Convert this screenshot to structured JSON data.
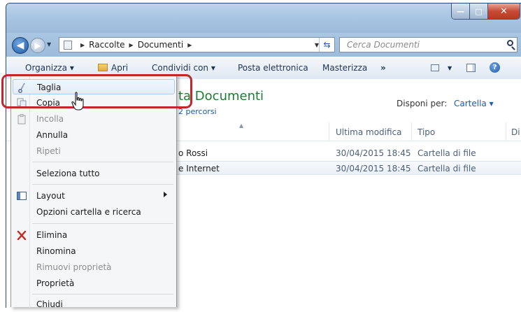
{
  "window": {
    "minimize": "—",
    "maximize": "□",
    "close": "✕"
  },
  "address": {
    "crumbs": [
      "Raccolte",
      "Documenti"
    ]
  },
  "search": {
    "placeholder": "Cerca Documenti"
  },
  "toolbar": {
    "organizza": "Organizza ▾",
    "apri": "Apri",
    "condividi": "Condividi con ▾",
    "posta": "Posta elettronica",
    "masterizza": "Masterizza",
    "more": "»"
  },
  "library": {
    "title": "ta Documenti",
    "subtitle": "2 percorsi",
    "arrange_label": "Disponi per:",
    "arrange_value": "Cartella ▾"
  },
  "columns": {
    "modified": "Ultima modifica",
    "type": "Tipo",
    "size": "Di"
  },
  "rows": [
    {
      "name": "o Rossi",
      "modified": "30/04/2015 18:45",
      "type": "Cartella di file"
    },
    {
      "name": "e Internet",
      "modified": "30/04/2015 18:45",
      "type": "Cartella di file"
    }
  ],
  "menu": {
    "taglia": "Taglia",
    "copia": "Copia",
    "incolla": "Incolla",
    "annulla": "Annulla",
    "ripeti": "Ripeti",
    "seleziona": "Seleziona tutto",
    "layout": "Layout",
    "opzioni": "Opzioni cartella e ricerca",
    "elimina": "Elimina",
    "rinomina": "Rinomina",
    "rimuovi": "Rimuovi proprietà",
    "proprieta": "Proprietà",
    "chiudi": "Chiudi"
  },
  "icons": [
    "back-arrow-icon",
    "forward-arrow-icon",
    "folder-icon",
    "refresh-icon",
    "search-icon",
    "open-folder-icon",
    "views-icon",
    "preview-pane-icon",
    "help-icon",
    "scissors-icon",
    "copy-icon",
    "paste-icon",
    "layout-icon",
    "delete-x-icon",
    "mouse-pointer-icon"
  ],
  "colors": {
    "highlight_frame": "#c0282d",
    "library_title": "#1e7b34",
    "link_blue": "#1e5aa8",
    "delete_red": "#d0211a"
  }
}
